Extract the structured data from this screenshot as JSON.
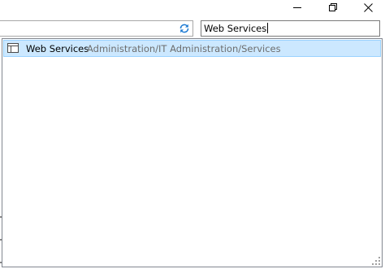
{
  "window": {
    "controls": [
      {
        "name": "minimize",
        "icon": "minimize-icon"
      },
      {
        "name": "restore",
        "icon": "restore-icon"
      },
      {
        "name": "close",
        "icon": "close-icon"
      }
    ]
  },
  "address_bar": {
    "value": "",
    "refresh_icon": "refresh-icon",
    "refresh_color": "#1e7bd3"
  },
  "search": {
    "value": "Web Services"
  },
  "results": [
    {
      "icon": "table-icon",
      "name": "Web Services",
      "path": "Administration/IT Administration/Services"
    }
  ],
  "colors": {
    "selection_bg": "#cce8ff",
    "selection_border": "#99d1ff",
    "path_text": "#6d6d6d"
  }
}
